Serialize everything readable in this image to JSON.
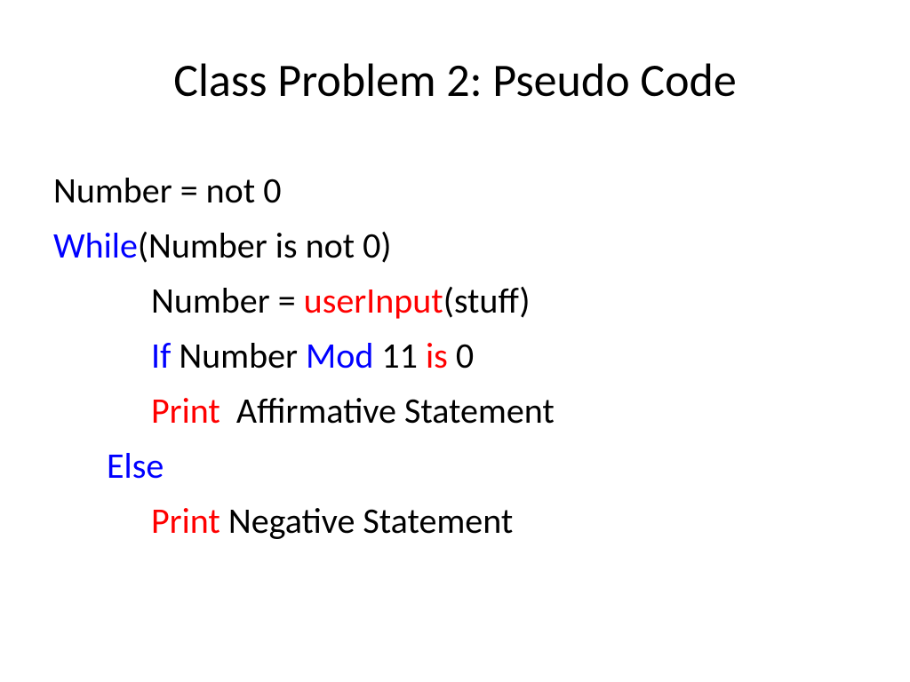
{
  "title": "Class Problem 2: Pseudo Code",
  "lines": {
    "l1": "Number = not 0",
    "l2_while": "While",
    "l2_rest": "(Number is not 0)",
    "l3_pre": "Number = ",
    "l3_fn": "userInput",
    "l3_post": "(stuff)",
    "l4_if": "If",
    "l4_mid1": " Number ",
    "l4_mod": "Mod",
    "l4_mid2": " 11 ",
    "l4_is": "is",
    "l4_end": " 0",
    "l5_print": "Print",
    "l5_rest": "  Affirmative Statement",
    "l6_else": "Else",
    "l7_print": "Print",
    "l7_rest": " Negative Statement"
  }
}
